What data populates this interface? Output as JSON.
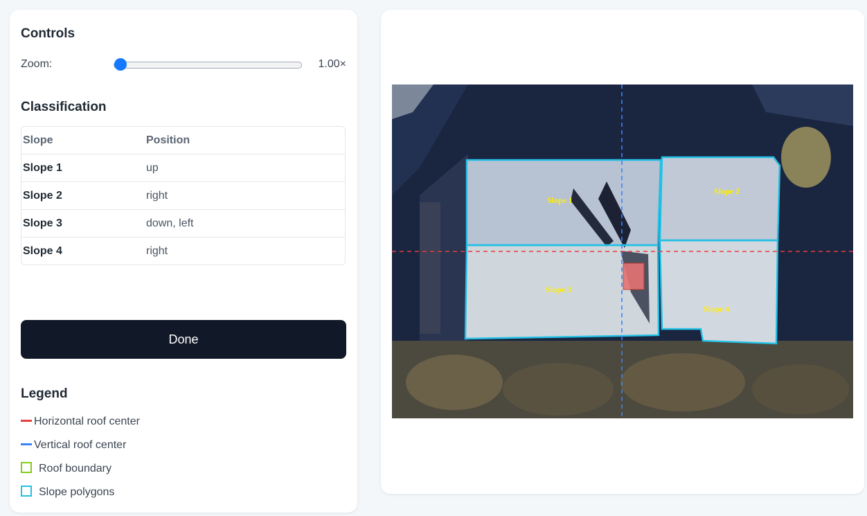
{
  "controls": {
    "title": "Controls",
    "zoom_label": "Zoom:",
    "zoom_value": "1.00×",
    "zoom_fraction": 0.0
  },
  "classification": {
    "title": "Classification",
    "headers": [
      "Slope",
      "Position"
    ],
    "rows": [
      {
        "slope": "Slope 1",
        "position": "up"
      },
      {
        "slope": "Slope 2",
        "position": "right"
      },
      {
        "slope": "Slope 3",
        "position": "down, left"
      },
      {
        "slope": "Slope 4",
        "position": "right"
      }
    ]
  },
  "done_label": "Done",
  "legend": {
    "title": "Legend",
    "items": [
      {
        "label": "Horizontal roof center",
        "color": "#e53e3e"
      },
      {
        "label": "Vertical roof center",
        "color": "#3b82f6"
      },
      {
        "label": "Roof boundary",
        "color": "#84cc16"
      },
      {
        "label": "Slope polygons",
        "color": "#22c1e6"
      }
    ]
  },
  "map": {
    "slope_labels": [
      "Slope 1",
      "Slope 2",
      "Slope 3",
      "Slope 4"
    ],
    "colors": {
      "slope_polygon": "#22c1e6",
      "horizontal_center": "#e53e3e",
      "vertical_center": "#3b82f6",
      "marker": "#e57373",
      "label": "#ffee00"
    }
  }
}
